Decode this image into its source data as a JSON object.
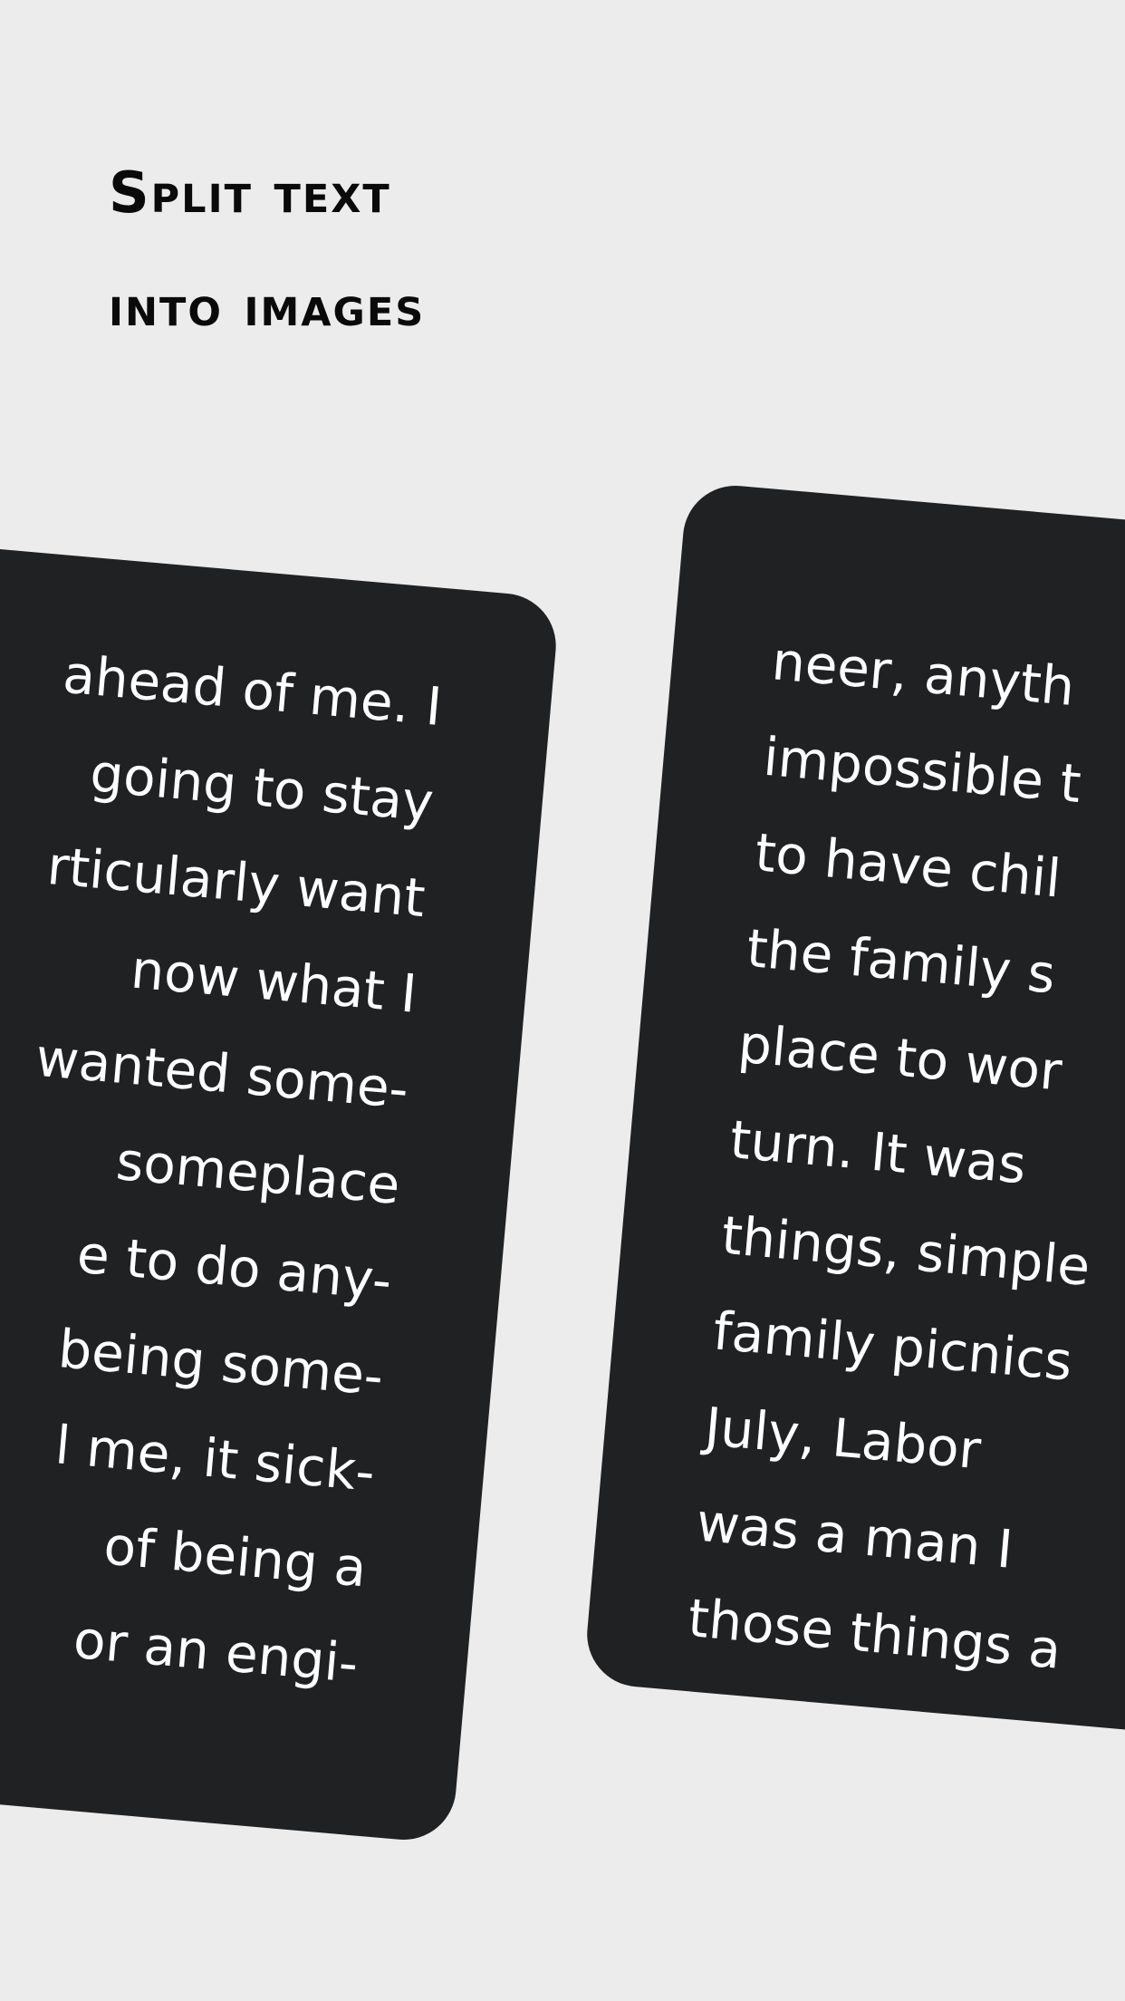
{
  "headline": {
    "line1": "Split text",
    "line2": "into images"
  },
  "card_left": {
    "lines": [
      "ahead of me. I",
      "going to stay",
      "rticularly want",
      "now what I",
      "wanted some-",
      "someplace",
      "e to do any-",
      "being some-",
      "l me, it sick-",
      "of being a",
      "or an engi-"
    ]
  },
  "card_right": {
    "lines": [
      "neer, anyth",
      "impossible t",
      "to have chil",
      "the family s",
      "place to wor",
      "turn. It was",
      "things, simple",
      "family picnics",
      "July, Labor",
      "was a man I",
      "those things a"
    ]
  },
  "colors": {
    "background": "#ececec",
    "card": "#202123",
    "card_text": "#ffffff",
    "headline": "#0a0a0a"
  }
}
